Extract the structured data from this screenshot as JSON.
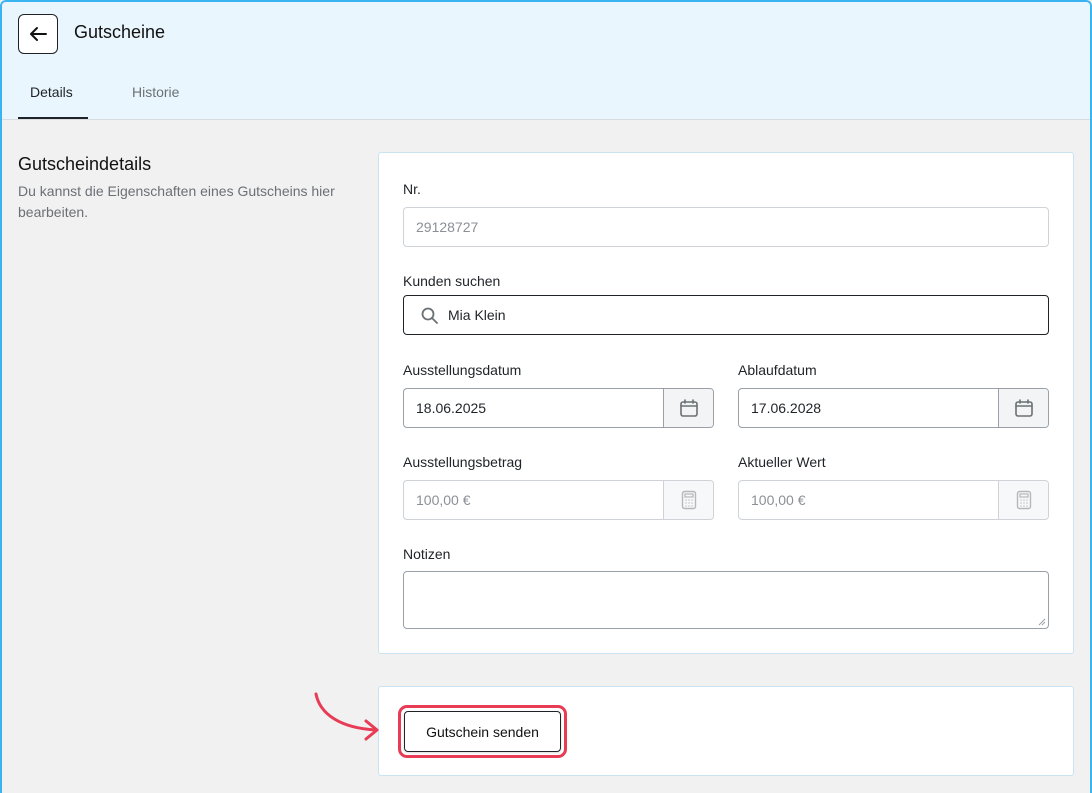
{
  "header": {
    "title": "Gutscheine",
    "tabs": [
      {
        "label": "Details",
        "active": true
      },
      {
        "label": "Historie",
        "active": false
      }
    ]
  },
  "section": {
    "title": "Gutscheindetails",
    "description": "Du kannst die Eigenschaften eines Gutscheins hier bearbeiten."
  },
  "form": {
    "number": {
      "label": "Nr.",
      "value": "29128727"
    },
    "customer": {
      "label": "Kunden suchen",
      "value": "Mia Klein"
    },
    "issue_date": {
      "label": "Ausstellungsdatum",
      "value": "18.06.2025"
    },
    "expiry_date": {
      "label": "Ablaufdatum",
      "value": "17.06.2028"
    },
    "issue_amount": {
      "label": "Ausstellungsbetrag",
      "value": "100,00 €"
    },
    "current_value": {
      "label": "Aktueller Wert",
      "value": "100,00 €"
    },
    "notes": {
      "label": "Notizen",
      "value": ""
    }
  },
  "actions": {
    "send_label": "Gutschein senden"
  },
  "colors": {
    "header_bg": "#e9f6fd",
    "frame_border": "#39b4f0",
    "highlight": "#e83b55",
    "page_bg": "#f1f1f2"
  },
  "icons": [
    "back-arrow-icon",
    "search-icon",
    "calendar-icon",
    "calculator-icon"
  ]
}
